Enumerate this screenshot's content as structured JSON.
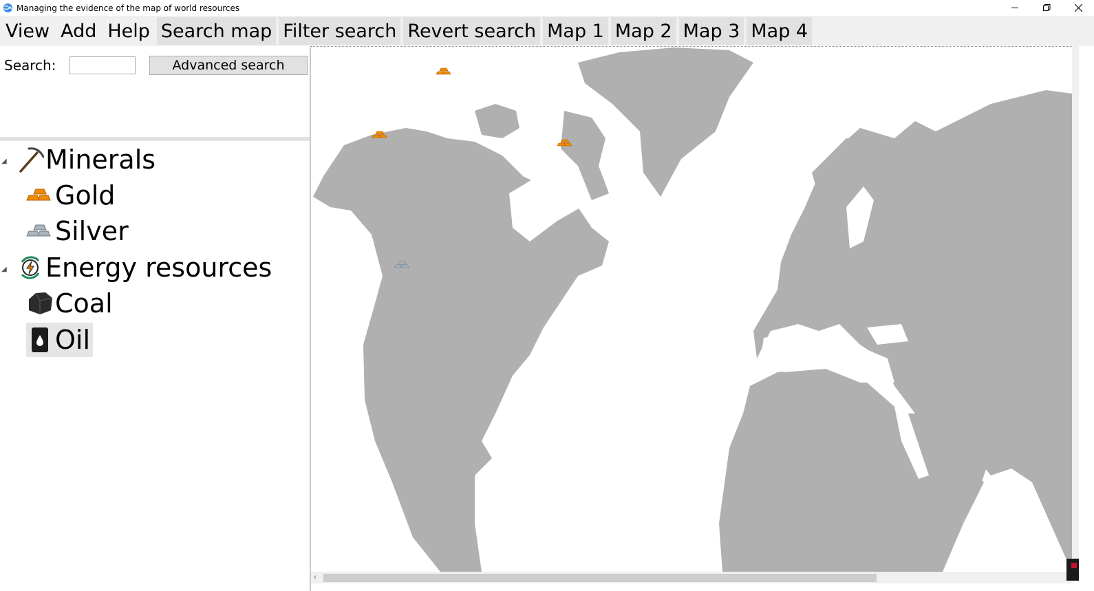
{
  "window": {
    "title": "Managing the evidence of the map of world resources",
    "controls": [
      "minimize-icon",
      "restore-icon",
      "close-icon"
    ]
  },
  "menubar": {
    "items": [
      {
        "label": "View",
        "button": false
      },
      {
        "label": "Add",
        "button": false
      },
      {
        "label": "Help",
        "button": false
      },
      {
        "label": "Search map",
        "button": true
      },
      {
        "label": "Filter search",
        "button": true
      },
      {
        "label": "Revert search",
        "button": true
      },
      {
        "label": "Map 1",
        "button": true
      },
      {
        "label": "Map 2",
        "button": true
      },
      {
        "label": "Map 3",
        "button": true
      },
      {
        "label": "Map 4",
        "button": true
      }
    ]
  },
  "search": {
    "label": "Search:",
    "value": "",
    "advanced_button": "Advanced search"
  },
  "tree": {
    "categories": [
      {
        "label": "Minerals",
        "icon": "pickaxe-icon",
        "expanded": true,
        "children": [
          {
            "label": "Gold",
            "icon": "gold-bars-icon"
          },
          {
            "label": "Silver",
            "icon": "silver-bars-icon"
          }
        ]
      },
      {
        "label": "Energy resources",
        "icon": "energy-icon",
        "expanded": true,
        "children": [
          {
            "label": "Coal",
            "icon": "coal-icon"
          },
          {
            "label": "Oil",
            "icon": "oil-barrel-icon",
            "selected": true
          }
        ]
      }
    ]
  },
  "map": {
    "land_color": "#b0b0b0",
    "water_color": "#ffffff",
    "markers": [
      {
        "resource": "Gold",
        "color": "#f08c00"
      },
      {
        "resource": "Gold",
        "color": "#f08c00"
      },
      {
        "resource": "Gold",
        "color": "#f08c00"
      },
      {
        "resource": "Silver",
        "color": "#8a9aa6"
      }
    ]
  }
}
